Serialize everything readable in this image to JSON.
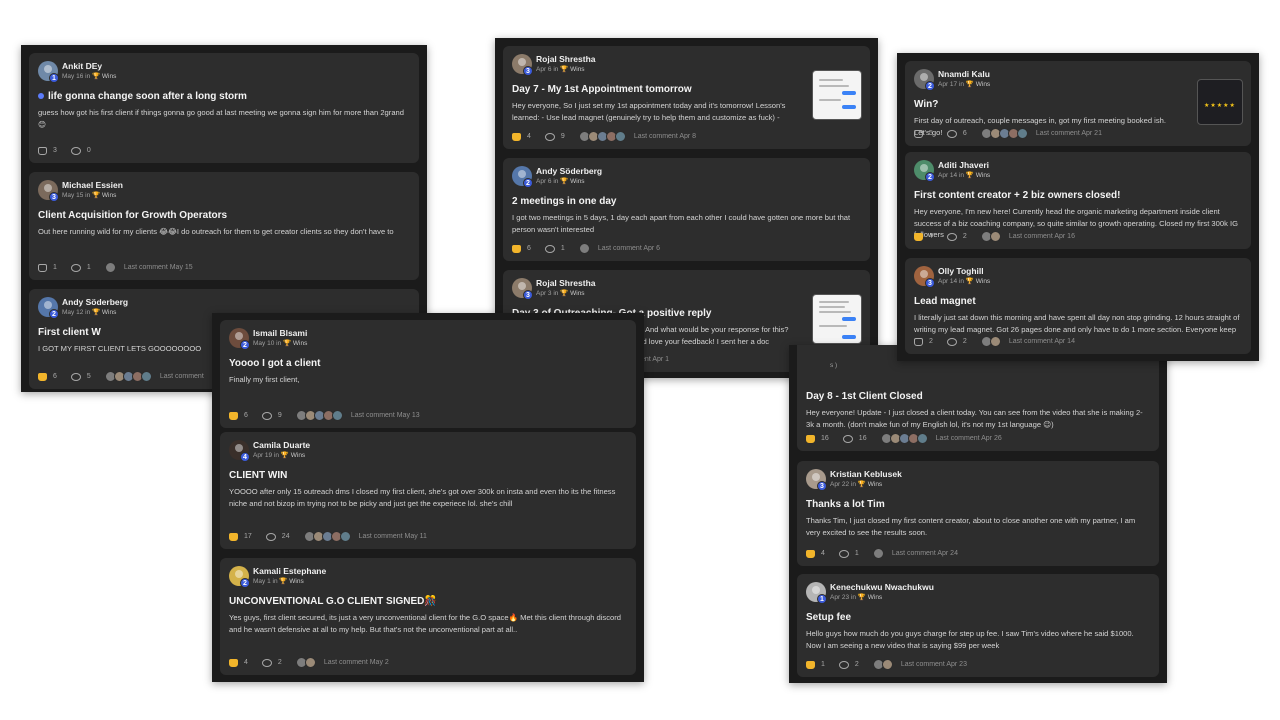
{
  "category_label": "🏆 Wins",
  "panels": {
    "a": [
      {
        "author": "Ankit DEy",
        "level": "1",
        "date": "May 16 in",
        "title": "life gonna change soon after a long storm",
        "body": "guess how got his first client if things gonna go good at last meeting we gonna sign him for more than 2grand 😊",
        "likes": "3",
        "comments": "0",
        "last": ""
      },
      {
        "author": "Michael Essien",
        "level": "3",
        "date": "May 15 in",
        "title": "Client Acquisition for Growth Operators",
        "body": "Out here running wild for my clients 😂😂I do outreach for them to get creator clients so they don't have to",
        "likes": "1",
        "comments": "1",
        "last": "Last comment May 15"
      },
      {
        "author": "Andy Söderberg",
        "level": "2",
        "date": "May 12 in",
        "title": "First client W",
        "body": "I GOT MY FIRST CLIENT LETS GOOOOOOOO",
        "likes": "6",
        "comments": "5",
        "last": "Last comment"
      }
    ],
    "b": [
      {
        "author": "Ismail Blsami",
        "level": "2",
        "date": "May 10 in",
        "title": "Yoooo I got a client",
        "body": "Finally my first client,",
        "likes": "6",
        "comments": "9",
        "last": "Last comment May 13"
      },
      {
        "author": "Camila Duarte",
        "level": "4",
        "date": "Apr 19 in",
        "title": "CLIENT WIN",
        "body": "YOOOO after only 15 outreach dms I closed my first client, she's got over 300k on insta and even tho its the fitness niche and not bizop im trying not to be picky and just get the experiece lol. she's chill",
        "likes": "17",
        "comments": "24",
        "last": "Last comment May 11"
      },
      {
        "author": "Kamali Estephane",
        "level": "2",
        "date": "May 1 in",
        "title": "UNCONVENTIONAL G.O CLIENT SIGNED🎊",
        "body": "Yes guys, first client secured, its just a very unconventional client for the G.O space🔥 Met this client through discord and he wasn't defensive at all to my help. But that's not the unconventional part at all..",
        "likes": "4",
        "comments": "2",
        "last": "Last comment May 2"
      }
    ],
    "c": [
      {
        "author": "Rojal Shrestha",
        "level": "3",
        "date": "Apr 6 in",
        "title": "Day 7 - My 1st Appointment tomorrow",
        "body": "Hey everyone, So I just set my 1st appointment today and it's tomorrow! Lesson's learned: - Use lead magnet (genuinely try to help them and customize as fuck) -",
        "likes": "4",
        "comments": "9",
        "last": "Last comment Apr 8"
      },
      {
        "author": "Andy Söderberg",
        "level": "2",
        "date": "Apr 6 in",
        "title": "2 meetings in one day",
        "body": "I got two meetings in 5 days, 1 day each apart from each other I could have gotten one more but that person wasn't interested",
        "likes": "6",
        "comments": "1",
        "last": "Last comment Apr 6"
      },
      {
        "author": "Rojal Shrestha",
        "level": "3",
        "date": "Apr 3 in",
        "title": "Day 3 of Outreaching- Got a positive reply",
        "body": "Is this an objection or genuine excuse? And what would be your response for this? Should I have done better here? I would love your feedback! I sent her a doc",
        "likes": "4",
        "comments": "3",
        "last": "Last comment Apr 1"
      }
    ],
    "d": [
      {
        "author": "Nnamdi Kalu",
        "level": "2",
        "date": "Apr 17 in",
        "title": "Win?",
        "body": "First day of outreach, couple messages in, got my first meeting booked ish. Let's go!",
        "likes": "5",
        "comments": "6",
        "last": "Last comment Apr 21"
      },
      {
        "author": "Aditi Jhaveri",
        "level": "2",
        "date": "Apr 14 in",
        "title": "First content creator + 2 biz owners closed!",
        "body": "Hey everyone, I'm new here! Currently head the organic marketing department inside client success of a biz coaching company, so quite similar to growth operating. Closed my first 300k IG followers",
        "likes": "4",
        "comments": "2",
        "last": "Last comment Apr 16"
      },
      {
        "author": "Olly Toghill",
        "level": "3",
        "date": "Apr 14 in",
        "title": "Lead magnet",
        "body": "I literally just sat down this morning and have spent all day non stop grinding. 12 hours straight of writing my lead magnet. Got 26 pages done and only have to do 1 more section. Everyone keep",
        "likes": "2",
        "comments": "2",
        "last": "Last comment Apr 14"
      }
    ],
    "e": [
      {
        "author": "",
        "level": "",
        "date": "s )",
        "title": "Day 8 - 1st Client Closed",
        "body": "Hey everyone! Update - I just closed a client today. You can see from the video that she is making 2-3k a month. (don't make fun of my English lol, it's not my 1st language 😉)",
        "likes": "16",
        "comments": "16",
        "last": "Last comment Apr 26"
      },
      {
        "author": "Kristian Keblusek",
        "level": "3",
        "date": "Apr 22 in",
        "title": "Thanks a lot Tim",
        "body": "Thanks Tim, I just closed my first content creator, about to close another one with my partner, I am very excited to see the results soon.",
        "likes": "4",
        "comments": "1",
        "last": "Last comment Apr 24"
      },
      {
        "author": "Kenechukwu Nwachukwu",
        "level": "1",
        "date": "Apr 23 in",
        "title": "Setup fee",
        "body": "Hello guys how much do you guys charge for step up fee. I saw Tim's video where he said $1000. Now I am seeing a new video that is saying $99 per week",
        "likes": "1",
        "comments": "2",
        "last": "Last comment Apr 23"
      }
    ]
  }
}
